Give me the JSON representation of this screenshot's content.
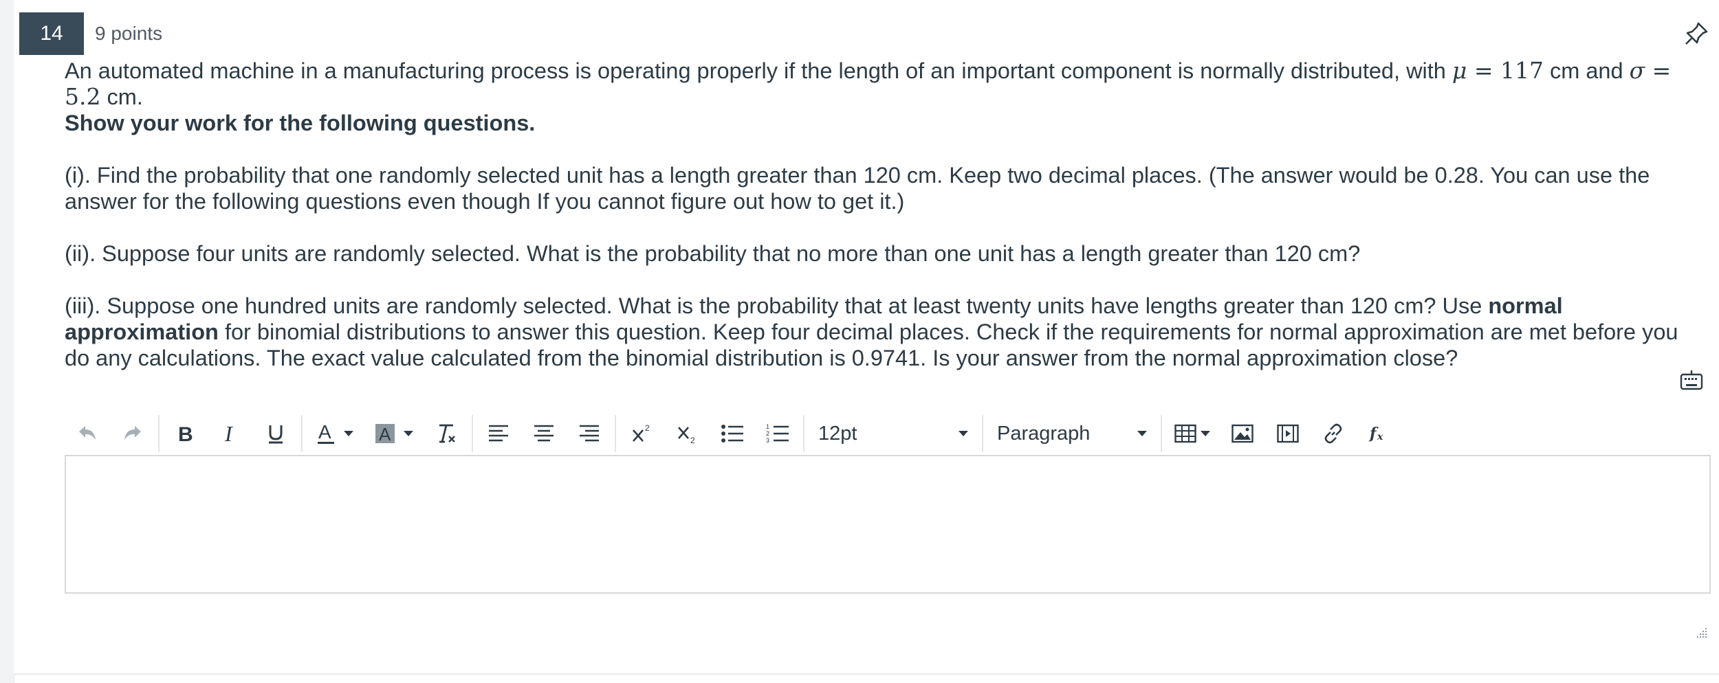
{
  "question": {
    "number": "14",
    "points": "9 points",
    "intro": {
      "before_mu": "An automated machine in a manufacturing process is operating properly if the length of an important component is normally distributed, with ",
      "mu_symbol": "μ",
      "mu_eq": " = 117",
      "between": " cm and ",
      "sigma_symbol": "σ",
      "sigma_eq": " = 5.2",
      "after_sigma": " cm.",
      "bold_line": "Show your work for the following questions."
    },
    "part_i": "(i). Find the probability that one randomly selected unit has a length greater than 120 cm. Keep two decimal places. (The answer would be 0.28. You can use the answer for the following questions even though If you cannot figure out how to get it.)",
    "part_ii": "(ii). Suppose four units are randomly selected. What is the probability that no more than one unit has a length greater than 120 cm?",
    "part_iii": {
      "before_bold": "(iii). Suppose one hundred units are randomly selected. What is the probability that at least twenty units have lengths greater than 120 cm? Use ",
      "bold": "normal approximation",
      "after_bold": " for binomial distributions to answer this question. Keep four decimal places. Check if the requirements for normal approximation are met before you do any calculations. The exact value calculated from the binomial distribution is 0.9741. Is your answer from the normal approximation close?"
    }
  },
  "editor": {
    "font_size": "12pt",
    "block_format": "Paragraph",
    "toolbar_icons": [
      "undo-icon",
      "redo-icon",
      "bold-icon",
      "italic-icon",
      "underline-icon",
      "text-color-icon",
      "highlight-color-icon",
      "clear-formatting-icon",
      "align-left-icon",
      "align-center-icon",
      "align-right-icon",
      "superscript-icon",
      "subscript-icon",
      "bullet-list-icon",
      "numbered-list-icon",
      "table-icon",
      "image-icon",
      "media-icon",
      "link-icon",
      "equation-icon"
    ],
    "content": ""
  },
  "colors": {
    "badge": "#394b58",
    "text": "#2d3b45",
    "muted_icon": "#8b969e",
    "border": "#d6d8db"
  }
}
